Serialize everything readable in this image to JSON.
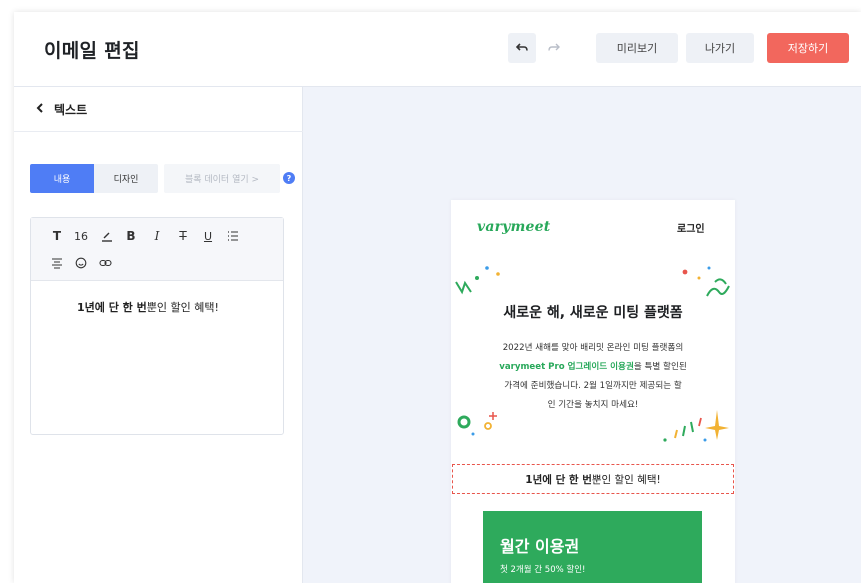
{
  "header": {
    "title": "이메일 편집",
    "undo_icon": "undo-icon",
    "redo_icon": "redo-icon",
    "preview_label": "미리보기",
    "exit_label": "나가기",
    "save_label": "저장하기"
  },
  "panel": {
    "back_icon": "chevron-left-icon",
    "title": "텍스트",
    "tabs": {
      "content": "내용",
      "design": "디자인",
      "block": "블록 데이터 열기  >"
    },
    "help": "?",
    "toolbar": {
      "text_style": "T",
      "font_size": "16",
      "bold": "B",
      "italic": "I",
      "strike": "T",
      "underline": "U"
    },
    "editor": {
      "bold_part": "1년에 단 한 번",
      "rest_part": "뿐인 할인 혜택!"
    }
  },
  "email": {
    "logo": "varymeet",
    "login": "로그인",
    "hero_title": "새로운 해, 새로운 미팅 플랫폼",
    "hero_line1": "2022년 새해를 맞아 배리밋 온라인 미팅 플랫폼의",
    "hero_line2_highlight": "varymeet Pro 업그레이드 이용권",
    "hero_line2_rest": "을 특별 할인된",
    "hero_line3": "가격에 준비했습니다. 2월 1일까지만 제공되는 할",
    "hero_line4": "인 기간을 놓치지 마세요!",
    "selected_bold": "1년에 단 한 번",
    "selected_rest": "뿐인 할인 혜택!",
    "plan_name": "월간 이용권",
    "plan_desc": "첫 2개월 간 50% 할인!"
  },
  "colors": {
    "accent_blue": "#4f7df5",
    "save_red": "#f2675d",
    "brand_green": "#28a85a",
    "plan_green": "#2eaa5c"
  }
}
